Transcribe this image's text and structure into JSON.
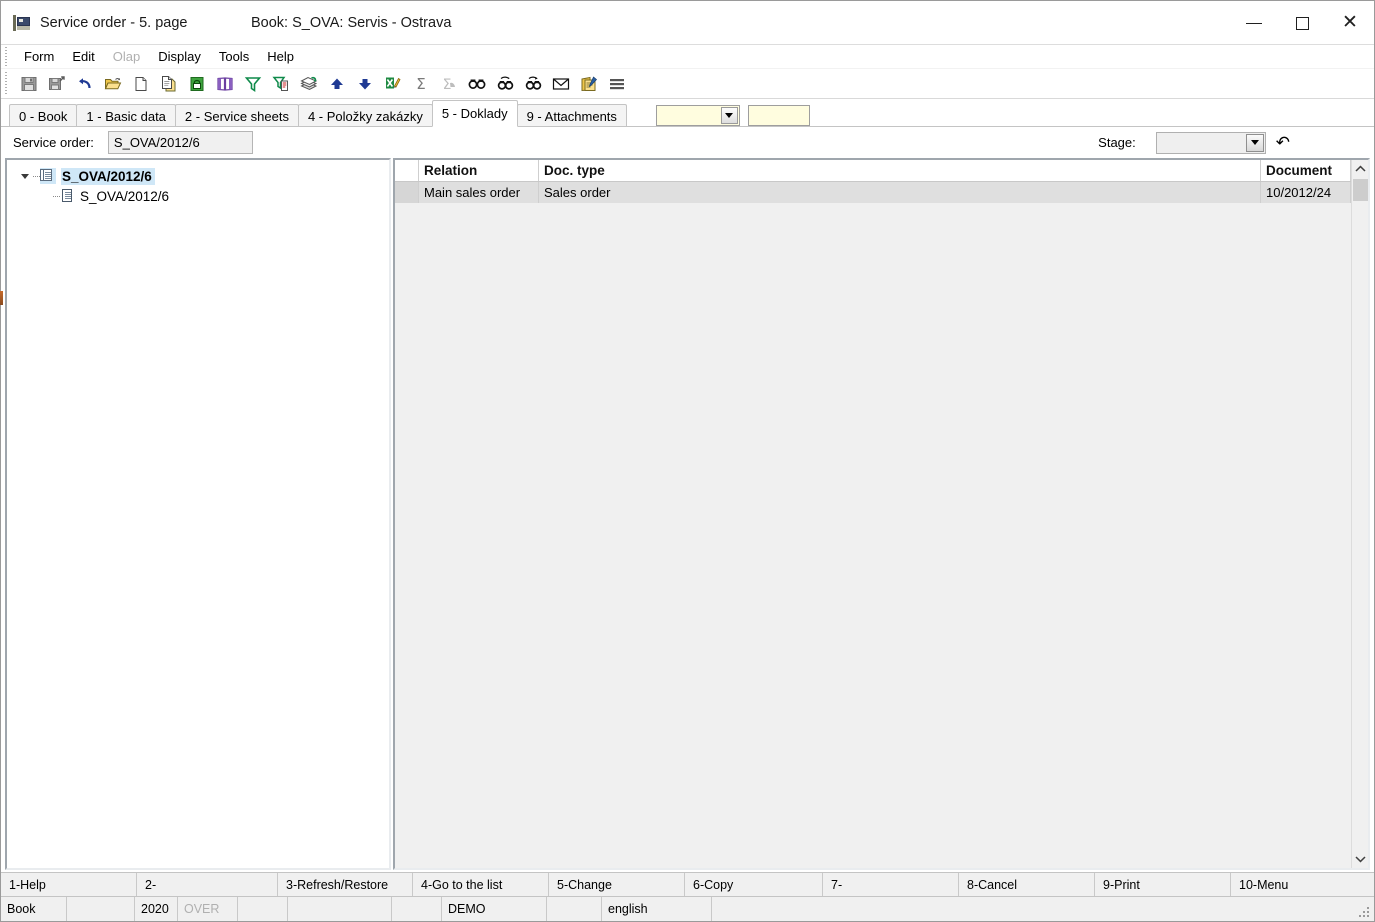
{
  "window": {
    "title": "Service order - 5. page",
    "book_title": "Book: S_OVA: Servis - Ostrava",
    "app_icon": "k2-app-icon",
    "controls": {
      "minimize": "minimize-icon",
      "maximize": "maximize-icon",
      "close": "close-icon"
    }
  },
  "menu": {
    "items": [
      {
        "label": "Form",
        "disabled": false
      },
      {
        "label": "Edit",
        "disabled": false
      },
      {
        "label": "Olap",
        "disabled": true
      },
      {
        "label": "Display",
        "disabled": false
      },
      {
        "label": "Tools",
        "disabled": false
      },
      {
        "label": "Help",
        "disabled": false
      }
    ]
  },
  "toolbar": {
    "buttons": [
      {
        "name": "save-icon",
        "title": "Save"
      },
      {
        "name": "save-and-close-icon",
        "title": "Save and close"
      },
      {
        "name": "undo-icon",
        "title": "Undo"
      },
      {
        "name": "open-folder-icon",
        "title": "Open"
      },
      {
        "name": "new-document-icon",
        "title": "New"
      },
      {
        "name": "copy-document-icon",
        "title": "Copy"
      },
      {
        "name": "lock-icon",
        "title": "Lock"
      },
      {
        "name": "book-icon",
        "title": "Book"
      },
      {
        "name": "filter-icon",
        "title": "Filter"
      },
      {
        "name": "filter-edit-icon",
        "title": "Edit filter"
      },
      {
        "name": "print-stack-icon",
        "title": "Print"
      },
      {
        "name": "move-up-icon",
        "title": "Move up"
      },
      {
        "name": "move-down-icon",
        "title": "Move down"
      },
      {
        "name": "export-excel-icon",
        "title": "Export to Excel"
      },
      {
        "name": "sum-icon",
        "title": "Sum"
      },
      {
        "name": "sum-filtered-icon",
        "title": "Sum filtered"
      },
      {
        "name": "find-icon",
        "title": "Find"
      },
      {
        "name": "find-next-icon",
        "title": "Find next"
      },
      {
        "name": "find-previous-icon",
        "title": "Find previous"
      },
      {
        "name": "mail-icon",
        "title": "Send mail"
      },
      {
        "name": "notes-icon",
        "title": "Notes"
      },
      {
        "name": "menu-lines-icon",
        "title": "Menu"
      }
    ]
  },
  "tabs": {
    "items": [
      {
        "label": "0 - Book",
        "active": false
      },
      {
        "label": "1 - Basic data",
        "active": false
      },
      {
        "label": "2 - Service sheets",
        "active": false
      },
      {
        "label": "4 - Položky zakázky",
        "active": false
      },
      {
        "label": "5 - Doklady",
        "active": true
      },
      {
        "label": "9 - Attachments",
        "active": false
      }
    ],
    "combo_value": "",
    "field_value": ""
  },
  "header": {
    "service_order_label": "Service order:",
    "service_order_value": "S_OVA/2012/6",
    "stage_label": "Stage:",
    "stage_value": "",
    "refresh_icon": "undo-history-icon"
  },
  "tree": {
    "nodes": [
      {
        "label": "S_OVA/2012/6",
        "level": 0,
        "selected": true,
        "expanded": true,
        "icon": "documents-stack-icon"
      },
      {
        "label": "S_OVA/2012/6",
        "level": 1,
        "selected": false,
        "expanded": false,
        "icon": "document-icon"
      }
    ]
  },
  "grid": {
    "columns": [
      {
        "label": "Relation"
      },
      {
        "label": "Doc. type"
      },
      {
        "label": "Document"
      }
    ],
    "sort_indicator": "caret-up-icon",
    "rows": [
      {
        "relation": "Main sales order",
        "doc_type": "Sales order",
        "document": "10/2012/24"
      }
    ]
  },
  "scrollbar": {
    "up_arrow": "chevron-up-icon",
    "down_arrow": "chevron-down-icon"
  },
  "function_keys": [
    {
      "label": "1-Help"
    },
    {
      "label": "2-"
    },
    {
      "label": "3-Refresh/Restore"
    },
    {
      "label": "4-Go to the list"
    },
    {
      "label": "5-Change"
    },
    {
      "label": "6-Copy"
    },
    {
      "label": "7-"
    },
    {
      "label": "8-Cancel"
    },
    {
      "label": "9-Print"
    },
    {
      "label": "10-Menu"
    }
  ],
  "status_bar": {
    "cells": [
      {
        "label": "Book",
        "dim": false
      },
      {
        "label": "",
        "dim": false
      },
      {
        "label": "2020",
        "dim": false
      },
      {
        "label": "OVER",
        "dim": true
      },
      {
        "label": "",
        "dim": false
      },
      {
        "label": "",
        "dim": false
      },
      {
        "label": "",
        "dim": false
      },
      {
        "label": "DEMO",
        "dim": false
      },
      {
        "label": "",
        "dim": false
      },
      {
        "label": "english",
        "dim": false
      },
      {
        "label": "",
        "dim": false
      }
    ]
  }
}
